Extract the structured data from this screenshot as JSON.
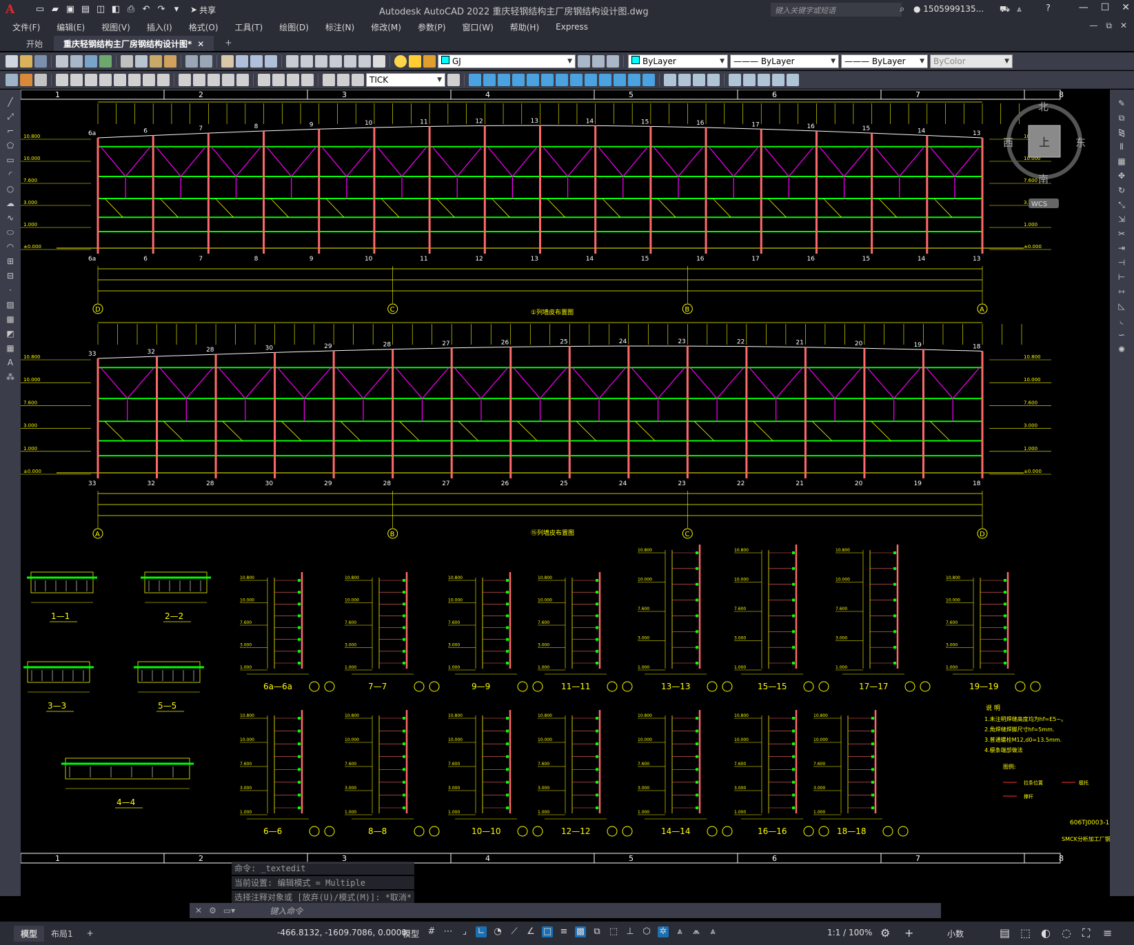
{
  "app": {
    "logo": "A",
    "title": "Autodesk AutoCAD 2022    重庆轻钢结构主厂房钢结构设计图.dwg",
    "search_placeholder": "键入关键字或短语",
    "user": "1505999135...",
    "share_label": "共享"
  },
  "menu": [
    "文件(F)",
    "编辑(E)",
    "视图(V)",
    "插入(I)",
    "格式(O)",
    "工具(T)",
    "绘图(D)",
    "标注(N)",
    "修改(M)",
    "参数(P)",
    "窗口(W)",
    "帮助(H)",
    "Express"
  ],
  "tabs": [
    {
      "label": "开始"
    },
    {
      "label": "重庆轻钢结构主厂房钢结构设计图*"
    }
  ],
  "toolbar": {
    "layer_name": "GJ",
    "color": "ByLayer",
    "linetype": "ByLayer",
    "lineweight": "ByLayer",
    "plotstyle": "ByColor",
    "dimstyle": "TICK"
  },
  "viewcube": {
    "north": "北",
    "south": "南",
    "east": "东",
    "west": "西",
    "top": "上",
    "wcs": "WCS"
  },
  "drawing": {
    "grid_top": [
      "1",
      "2",
      "3",
      "4",
      "5",
      "6",
      "7",
      "8"
    ],
    "elev1_title": "①列墙皮布置图",
    "elev2_title": "⑮列墙皮布置图",
    "elev1_axes": [
      "D",
      "C",
      "B",
      "A"
    ],
    "elev2_axes": [
      "A",
      "B",
      "C",
      "D"
    ],
    "elev1_cols": [
      "6a",
      "6",
      "7",
      "8",
      "9",
      "10",
      "11",
      "12",
      "13",
      "14",
      "15",
      "16",
      "17",
      "16",
      "15",
      "14",
      "13"
    ],
    "elev2_cols": [
      "33",
      "32",
      "28",
      "30",
      "29",
      "28",
      "27",
      "26",
      "25",
      "24",
      "23",
      "22",
      "21",
      "20",
      "19",
      "18"
    ],
    "elevations": [
      "10.800",
      "10.000",
      "7.600",
      "3.000",
      "1.000",
      "±0.000"
    ],
    "sections_left": [
      "1—1",
      "2—2",
      "3—3",
      "5—5",
      "4—4"
    ],
    "sections_upper": [
      "6a—6a",
      "7—7",
      "9—9",
      "11—11",
      "13—13",
      "15—15",
      "17—17",
      "19—19"
    ],
    "sections_lower": [
      "6—6",
      "8—8",
      "10—10",
      "12—12",
      "14—14",
      "16—16",
      "18—18"
    ],
    "notes_title": "说  明",
    "notes": [
      "1.未注明焊缝高度均为hf=E5~。",
      "2.角焊缝焊脚尺寸hf=5mm.",
      "3.普通螺栓M12,d0=13.5mm.",
      "4.檩条端部做法"
    ],
    "legend_title": "图例:",
    "legend": [
      "拉条位置",
      "撑杆",
      "檩托"
    ],
    "drawing_no": "606TJ0003-1",
    "company": "SMCK分析加工厂钢结构"
  },
  "command": {
    "history": [
      "命令: _textedit",
      "当前设置: 编辑模式 = Multiple",
      "选择注释对象或 [放弃(U)/模式(M)]: *取消*"
    ],
    "placeholder": "键入命令"
  },
  "status": {
    "layout_tabs": [
      "模型",
      "布局1"
    ],
    "coords": "-466.8132, -1609.7086, 0.0000",
    "space": "模型",
    "scale": "1:1 / 100%",
    "units": "小数"
  },
  "colors": {
    "beam": "#00ff00",
    "column": "#ff6a6a",
    "brace": "#ff00ff",
    "dims": "#ffff00",
    "aux": "#ffffff"
  }
}
